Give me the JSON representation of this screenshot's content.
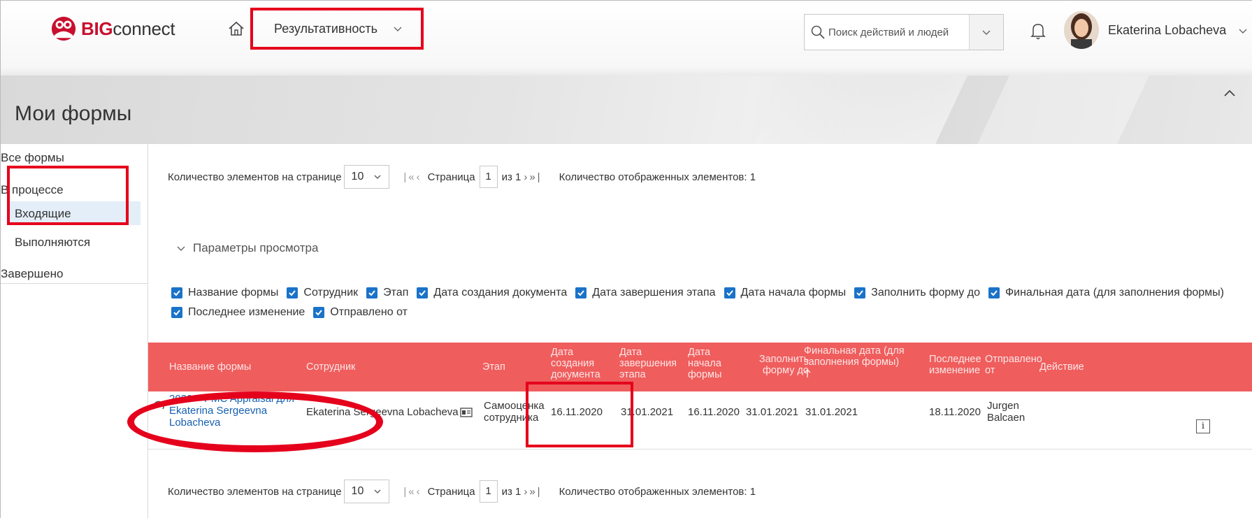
{
  "app": {
    "logo_big": "BIG",
    "logo_rest": "connect",
    "module": "Результативность",
    "search_placeholder": "Поиск действий и людей",
    "user_name": "Ekaterina Lobacheva"
  },
  "page": {
    "title": "Мои формы"
  },
  "sidebar": {
    "all_forms": "Все формы",
    "in_process": "В процессе",
    "incoming": "Входящие",
    "in_progress": "Выполняются",
    "completed": "Завершено"
  },
  "pager": {
    "items_per_page_label": "Количество элементов на странице",
    "items_per_page_value": "10",
    "first_prev": "|«‹",
    "page_label": "Страница",
    "page_value": "1",
    "of_label": "из 1",
    "next_last": "›»|",
    "count_label": "Количество отображенных элементов: 1"
  },
  "view_params": {
    "label": "Параметры просмотра",
    "checkboxes": [
      "Название формы",
      "Сотрудник",
      "Этап",
      "Дата создания документа",
      "Дата завершения этапа",
      "Дата начала формы",
      "Заполнить форму до",
      "Финальная дата (для заполнения формы)",
      "Последнее изменение",
      "Отправлено от"
    ]
  },
  "table": {
    "headers": {
      "form_name": "Название формы",
      "employee": "Сотрудник",
      "stage": "Этап",
      "doc_created": "Дата создания документа",
      "stage_end": "Дата завершения этапа",
      "form_start": "Дата начала формы",
      "fill_by": "Заполнить форму до",
      "final_date": "Финальная дата (для заполнения формы)",
      "last_change": "Последнее изменение",
      "sent_from": "Отправлено от",
      "actions": "Действие"
    },
    "row": {
      "form_name": "2020 – PMC Appraisal для Ekaterina Sergeevna Lobacheva",
      "employee": "Ekaterina Sergeevna Lobacheva",
      "stage": "Самооценка сотрудника",
      "doc_created": "16.11.2020",
      "stage_end": "31.01.2021",
      "form_start": "16.11.2020",
      "fill_by": "31.01.2021",
      "final_date": "31.01.2021",
      "last_change": "18.11.2020",
      "sent_from": "Jurgen Balcaen",
      "info": "i"
    }
  },
  "colors": {
    "accent_red": "#e5001c",
    "table_header": "#ef5d5d",
    "link_blue": "#1560b1",
    "checkbox_blue": "#1a73c8"
  }
}
